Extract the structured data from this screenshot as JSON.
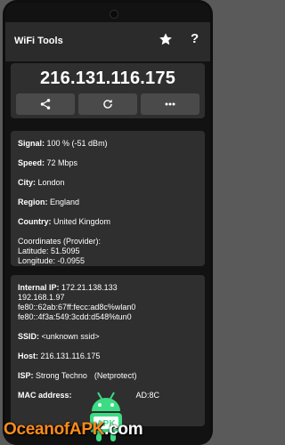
{
  "app": {
    "title": "WiFi Tools",
    "star_icon": "star-icon",
    "help_label": "?"
  },
  "ip": {
    "address": "216.131.116.175"
  },
  "actions": {
    "share_icon": "share-icon",
    "refresh_icon": "refresh-icon",
    "more_icon": "more-icon"
  },
  "wifi": {
    "signal_label": "Signal:",
    "signal_value": "100 % (-51 dBm)",
    "speed_label": "Speed:",
    "speed_value": "72 Mbps",
    "city_label": "City:",
    "city_value": "London",
    "region_label": "Region:",
    "region_value": "England",
    "country_label": "Country:",
    "country_value": "United Kingdom",
    "coords_label": "Coordinates (Provider):",
    "latitude": "Latitude: 51.5095",
    "longitude": "Longitude: -0.0955"
  },
  "network": {
    "internal_ip_label": "Internal IP:",
    "internal_ip_value": "172.21.138.133",
    "internal_ip_lines": [
      "192.168.1.97",
      "fe80::62ab:67ff:fecc:ad8c%wlan0",
      "fe80::4f3a:549:3cdd:d548%tun0"
    ],
    "ssid_label": "SSID:",
    "ssid_value": "<unknown ssid>",
    "host_label": "Host:",
    "host_value": "216.131.116.175",
    "isp_label": "ISP:",
    "isp_value_visible_1": "Strong Techno",
    "isp_value_visible_2": "(Netprotect)",
    "mac_label": "MAC address:",
    "mac_value_visible": "AD:8C"
  },
  "watermark": {
    "brand": "OceanofAPK",
    "domain": ".com",
    "logo_text": "APK",
    "colors": {
      "brand": "#ff8c1a",
      "logo": "#3ddc84"
    }
  }
}
